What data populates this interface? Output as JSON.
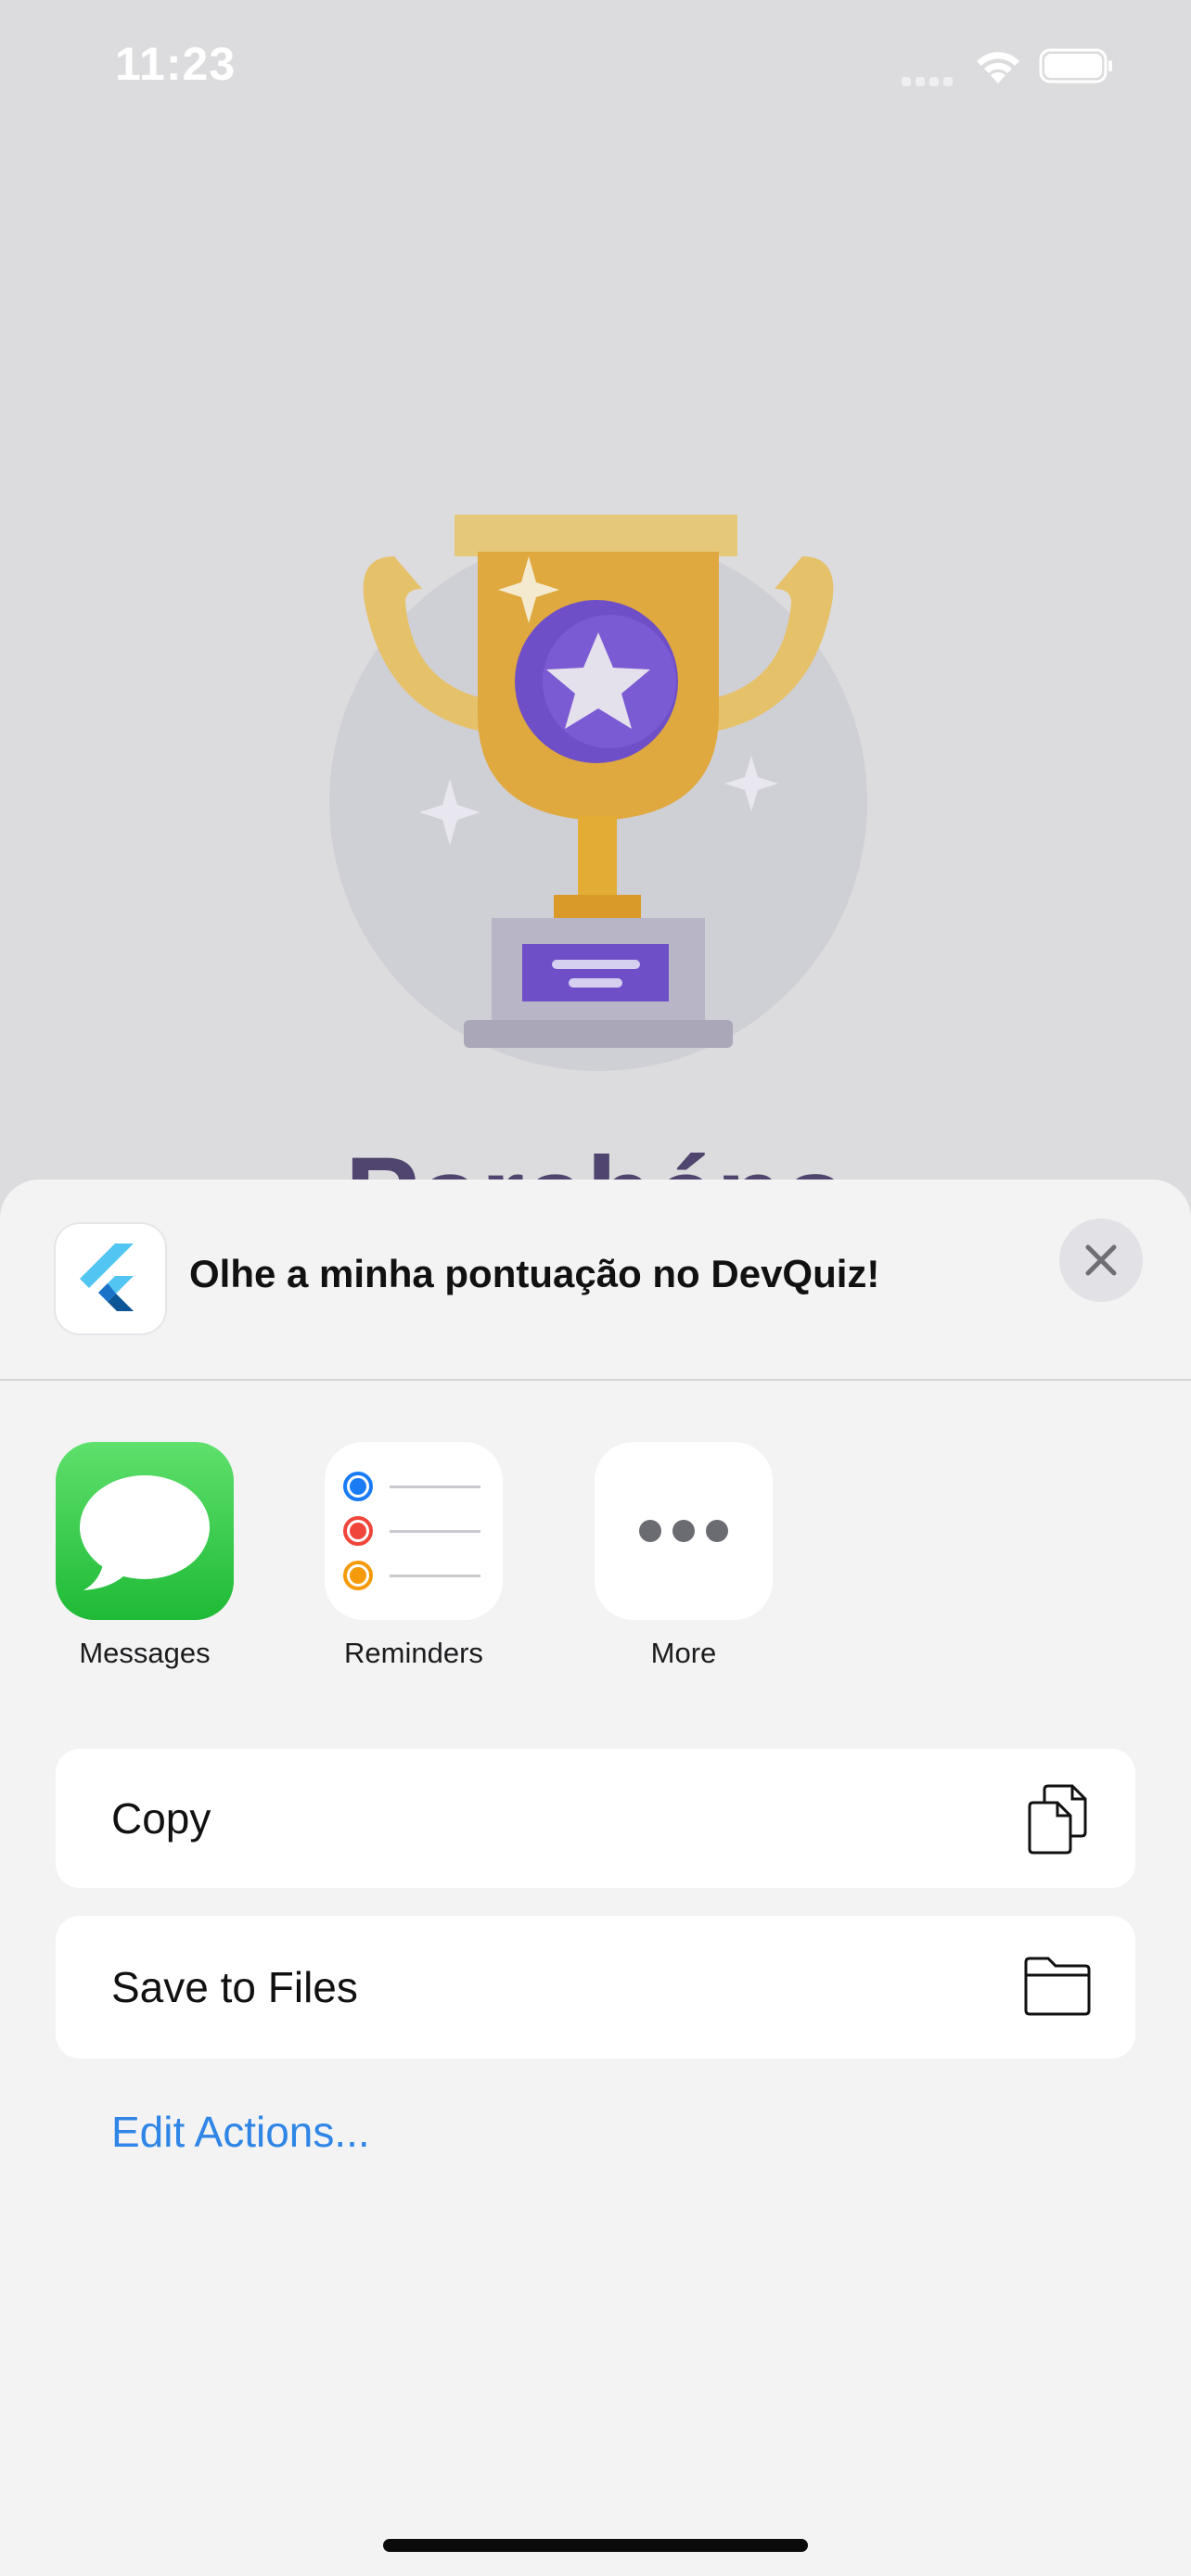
{
  "status_bar": {
    "time": "11:23"
  },
  "background": {
    "title": "Parabéns"
  },
  "share_sheet": {
    "title": "Olhe a minha pontuação no DevQuiz!",
    "apps": [
      {
        "label": "Messages",
        "icon": "messages-icon"
      },
      {
        "label": "Reminders",
        "icon": "reminders-icon"
      },
      {
        "label": "More",
        "icon": "ellipsis-icon"
      }
    ],
    "actions": [
      {
        "label": "Copy",
        "icon": "copy-icon"
      },
      {
        "label": "Save to Files",
        "icon": "folder-icon"
      }
    ],
    "edit_actions": "Edit Actions..."
  },
  "colors": {
    "accent": "#2f86e6",
    "messages_green": "#27c23e",
    "trophy_gold": "#e0a93f",
    "trophy_purple": "#6e4fc7"
  }
}
